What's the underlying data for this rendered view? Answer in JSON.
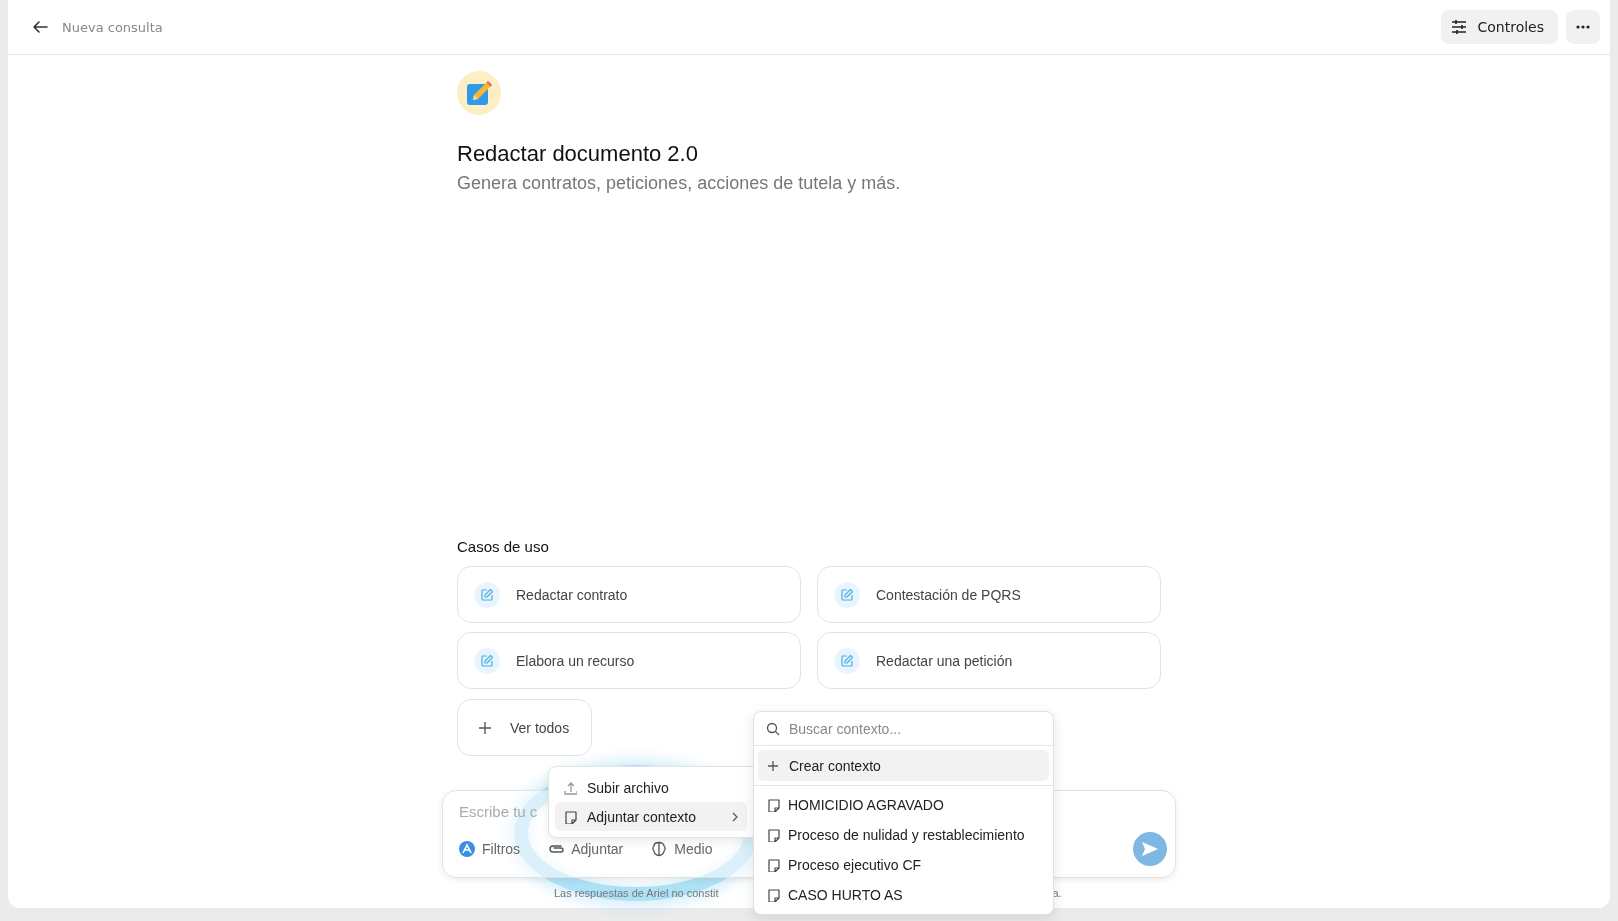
{
  "topbar": {
    "back_label": "Nueva consulta",
    "controls_button": "Controles"
  },
  "agent": {
    "title": "Redactar documento 2.0",
    "subtitle": "Genera contratos, peticiones, acciones de tutela y más."
  },
  "use_cases": {
    "heading": "Casos de uso",
    "items": [
      {
        "label": "Redactar contrato"
      },
      {
        "label": "Contestación de PQRS"
      },
      {
        "label": "Elabora un recurso"
      },
      {
        "label": "Redactar una petición"
      }
    ],
    "view_all": "Ver todos"
  },
  "composer": {
    "placeholder": "Escribe tu c",
    "tools": [
      {
        "label": "Filtros",
        "kind": "filters"
      },
      {
        "label": "Adjuntar",
        "kind": "attach"
      },
      {
        "label": "Medio",
        "kind": "brain"
      }
    ]
  },
  "footer_note": [
    "Las respuestas de Ariel no constit",
    "a."
  ],
  "attach_menu": {
    "items": [
      {
        "label": "Subir archivo",
        "kind": "upload",
        "selected": false,
        "submenu": false
      },
      {
        "label": "Adjuntar contexto",
        "kind": "context",
        "selected": true,
        "submenu": true
      }
    ]
  },
  "context_menu": {
    "search_placeholder": "Buscar contexto...",
    "create_label": "Crear contexto",
    "items": [
      {
        "label": "HOMICIDIO AGRAVADO"
      },
      {
        "label": "Proceso de nulidad y restablecimiento"
      },
      {
        "label": "Proceso ejecutivo CF"
      },
      {
        "label": "CASO HURTO AS"
      }
    ]
  },
  "annotation": {
    "kind": "ring"
  }
}
